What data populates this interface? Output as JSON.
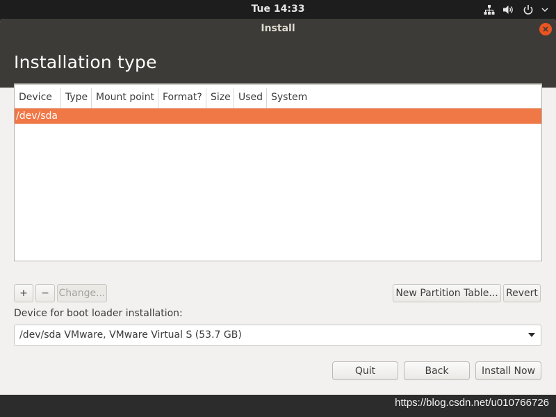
{
  "topbar": {
    "clock": "Tue 14:33",
    "icons": [
      "network-icon",
      "volume-icon",
      "power-icon",
      "chevron-down-icon"
    ]
  },
  "window": {
    "title": "Install",
    "page_title": "Installation type"
  },
  "partition_table": {
    "columns": [
      "Device",
      "Type",
      "Mount point",
      "Format?",
      "Size",
      "Used",
      "System"
    ],
    "rows": [
      {
        "device": "/dev/sda",
        "selected": true
      }
    ]
  },
  "toolbar": {
    "add_label": "+",
    "remove_label": "−",
    "change_label": "Change...",
    "new_table_label": "New Partition Table...",
    "revert_label": "Revert"
  },
  "bootloader": {
    "label": "Device for boot loader installation:",
    "selected": "/dev/sda VMware, VMware Virtual S (53.7 GB)"
  },
  "actions": {
    "quit_label": "Quit",
    "back_label": "Back",
    "install_label": "Install Now"
  },
  "watermark": "https://blog.csdn.net/u010766726",
  "colors": {
    "accent": "#e95420",
    "selection": "#f07746",
    "titlebar": "#3c3b37",
    "panel": "#1d1d1d"
  }
}
